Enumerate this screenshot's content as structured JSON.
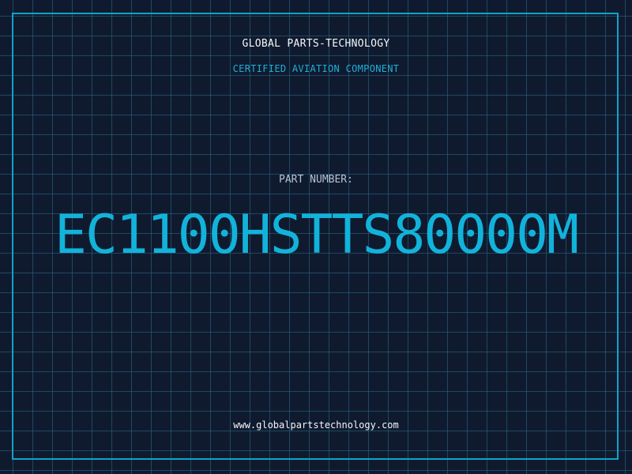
{
  "header": {
    "company": "GLOBAL PARTS-TECHNOLOGY",
    "tagline": "CERTIFIED AVIATION COMPONENT"
  },
  "part": {
    "label": "PART NUMBER:",
    "number": "EC1100HSTTS80000M"
  },
  "footer": {
    "website": "www.globalpartstechnology.com"
  },
  "colors": {
    "background": "#101a2e",
    "grid": "#286e8c",
    "frame": "#0fa3c9",
    "accent": "#12b3db",
    "text": "#f3f6fb"
  }
}
